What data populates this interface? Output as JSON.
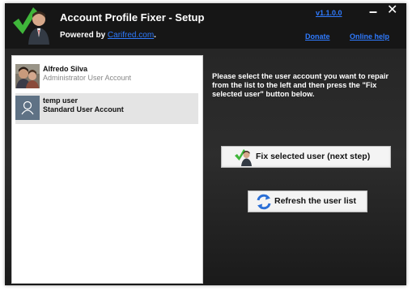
{
  "window": {
    "title": "Account Profile Fixer - Setup",
    "powered_by_prefix": "Powered by ",
    "powered_by_link": "Carifred.com",
    "powered_by_suffix": ".",
    "version": "v1.1.0.0",
    "minimize_glyph": "–",
    "close_glyph": "✕",
    "donate": "Donate",
    "online_help": "Online help"
  },
  "users": [
    {
      "name": "Alfredo Silva",
      "type": "Administrator User Account",
      "icon": "photo-avatar-icon",
      "selected": false
    },
    {
      "name": "temp user",
      "type": "Standard User Account",
      "icon": "generic-user-icon",
      "selected": true
    }
  ],
  "instructions": "Please select the user account you want to repair from the list to the left and then press the \"Fix selected user\" button below.",
  "buttons": {
    "fix": "Fix selected user (next step)",
    "refresh": "Refresh the user list"
  },
  "colors": {
    "link": "#2f7bff",
    "background": "#111111",
    "check_green": "#3fb63a",
    "refresh_blue": "#2b6fd6"
  }
}
